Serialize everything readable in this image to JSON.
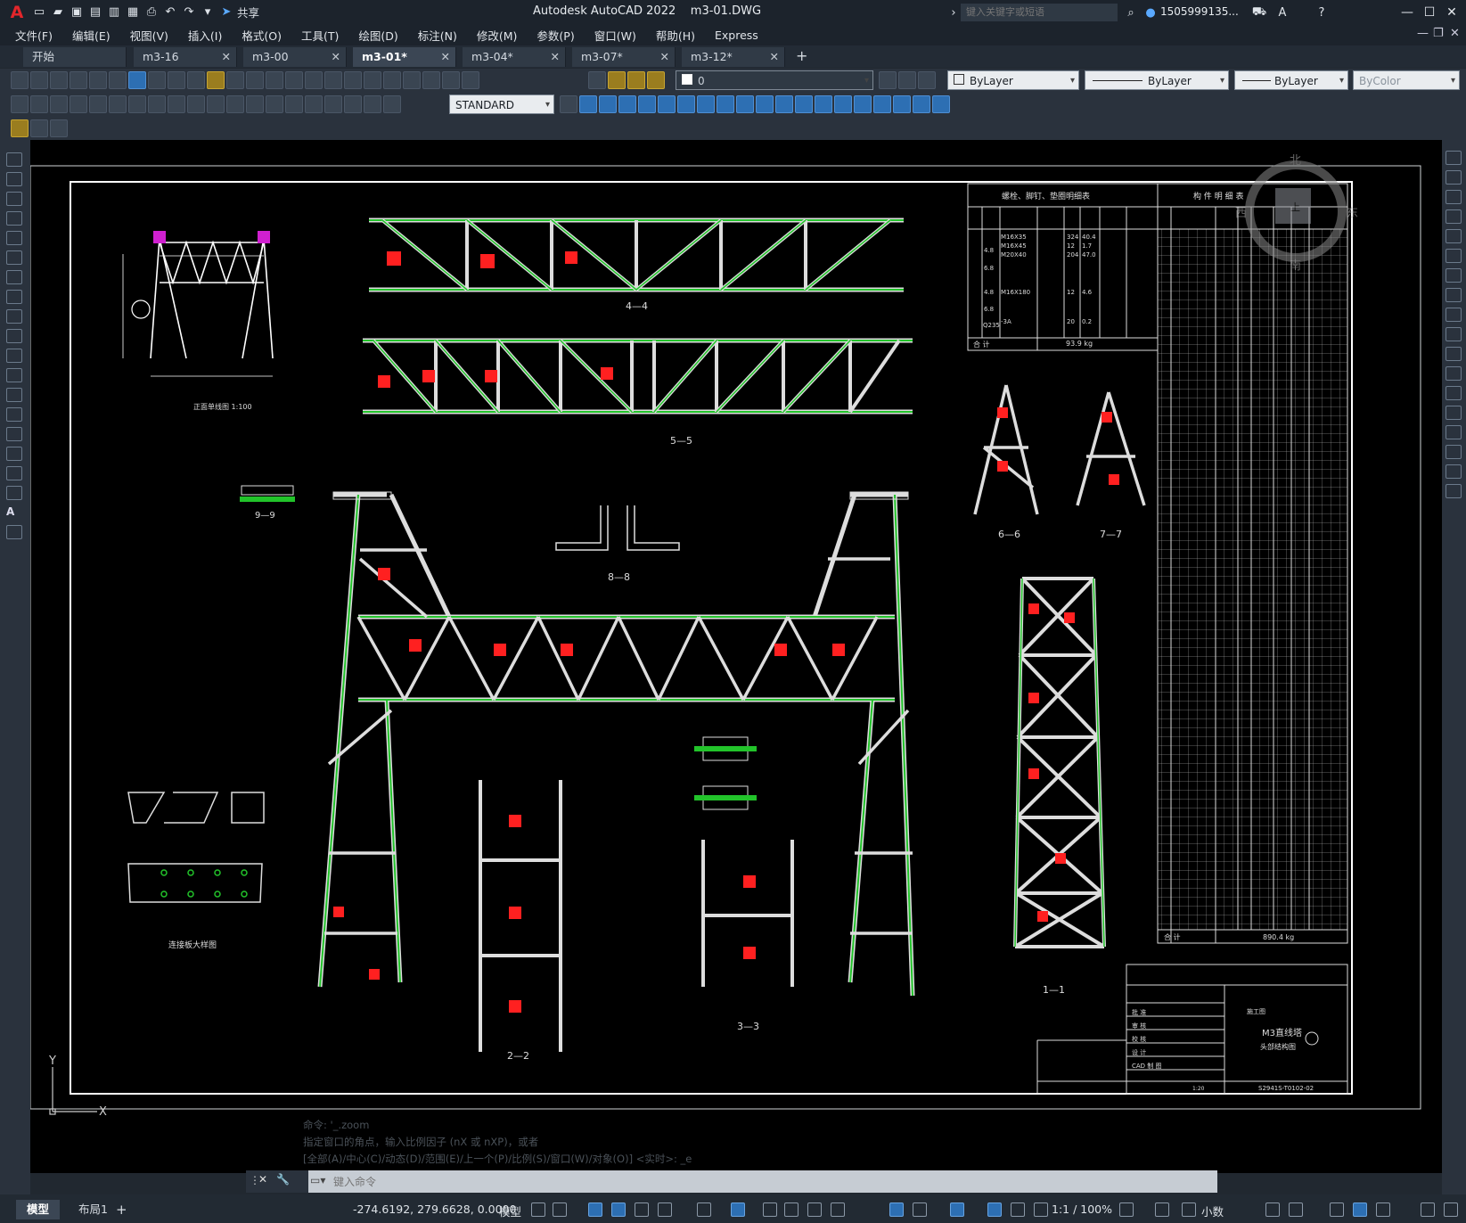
{
  "app": {
    "title": "Autodesk AutoCAD 2022",
    "file": "m3-01.DWG"
  },
  "quick_access": {
    "share_label": "共享"
  },
  "search": {
    "placeholder": "键入关键字或短语"
  },
  "user": {
    "name": "1505999135..."
  },
  "menu": [
    "文件(F)",
    "编辑(E)",
    "视图(V)",
    "插入(I)",
    "格式(O)",
    "工具(T)",
    "绘图(D)",
    "标注(N)",
    "修改(M)",
    "参数(P)",
    "窗口(W)",
    "帮助(H)",
    "Express"
  ],
  "tabs": [
    {
      "label": "开始",
      "closable": false
    },
    {
      "label": "m3-16",
      "closable": true
    },
    {
      "label": "m3-00",
      "closable": true
    },
    {
      "label": "m3-01*",
      "closable": true,
      "active": true
    },
    {
      "label": "m3-04*",
      "closable": true
    },
    {
      "label": "m3-07*",
      "closable": true
    },
    {
      "label": "m3-12*",
      "closable": true
    }
  ],
  "properties": {
    "layer": "0",
    "text_style": "STANDARD",
    "color": "ByLayer",
    "linetype": "ByLayer",
    "lineweight": "ByLayer",
    "plotstyle": "ByColor"
  },
  "viewcube": {
    "north": "北",
    "south": "南",
    "east": "东",
    "west": "西",
    "face": "上"
  },
  "drawing": {
    "sections": [
      "4—4",
      "5—5",
      "9—9",
      "8—8",
      "6—6",
      "7—7",
      "1—1",
      "2—2",
      "3—3"
    ],
    "front_view_label": "正面单线图  1:100",
    "plate_label": "连接板大样图",
    "bolt_table_title": "螺栓、脚钉、垫圈明细表",
    "bolt_table_total_label": "合 计",
    "bolt_total": "93.9 kg",
    "bolt_rows": [
      {
        "spec": "M16X35",
        "count": "324",
        "weight": "40.4"
      },
      {
        "spec": "M16X45",
        "count": "12",
        "weight": "1.7"
      },
      {
        "spec": "M20X40",
        "count": "204",
        "weight": "47.0"
      },
      {
        "spec": "M16X180",
        "count": "12",
        "weight": "4.6"
      },
      {
        "spec": "-3A",
        "count": "20",
        "weight": "0.2"
      }
    ],
    "grades": [
      "4.8",
      "6.8",
      "4.8",
      "6.8",
      "Q235"
    ],
    "parts_table_title": "构  件  明  细  表",
    "parts_total_label": "合 计",
    "parts_total": "890.4 kg",
    "title_block": {
      "name": "M3直线塔",
      "subtitle": "头部结构图",
      "drawing_no": "S2941S-T0102-02",
      "scale": "1:20",
      "phase": "施工图",
      "rows": [
        "批 准",
        "审 核",
        "校 核",
        "设 计",
        "CAD 制 图"
      ]
    }
  },
  "command": {
    "history": [
      "命令: '_.zoom",
      "指定窗口的角点，输入比例因子 (nX 或 nXP)，或者",
      "[全部(A)/中心(C)/动态(D)/范围(E)/上一个(P)/比例(S)/窗口(W)/对象(O)] <实时>: _e"
    ],
    "placeholder": "键入命令"
  },
  "status": {
    "model_tab": "模型",
    "layout_tab": "布局1",
    "coords": "-274.6192, 279.6628, 0.0000",
    "space": "模型",
    "scale": "1:1 / 100%",
    "units": "小数"
  }
}
